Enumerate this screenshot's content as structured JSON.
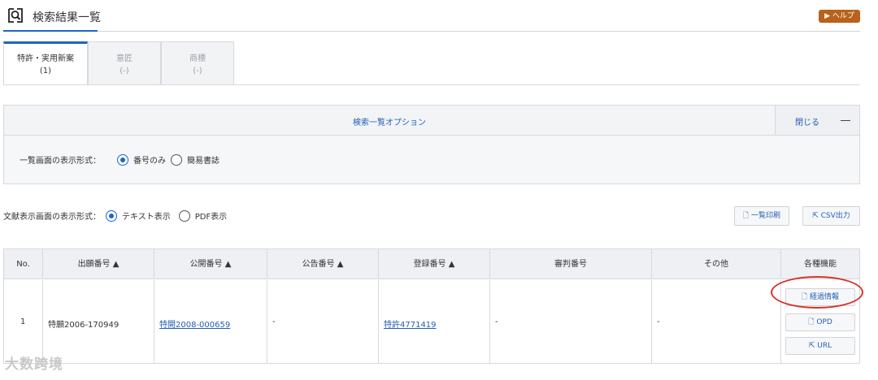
{
  "header": {
    "title": "検索結果一覧",
    "help_label": "▶ ヘルプ"
  },
  "tabs": [
    {
      "label": "特許・実用新案",
      "count": "(1)",
      "active": true
    },
    {
      "label": "意匠",
      "count": "(-)",
      "active": false
    },
    {
      "label": "商標",
      "count": "(-)",
      "active": false
    }
  ],
  "options": {
    "title": "検索一覧オプション",
    "close_label": "閉じる",
    "list_format_label": "一覧画面の表示形式：",
    "list_format_options": [
      "番号のみ",
      "簡易書誌"
    ],
    "list_format_selected": "番号のみ"
  },
  "doc_format": {
    "label": "文献表示画面の表示形式：",
    "options": [
      "テキスト表示",
      "PDF表示"
    ],
    "selected": "テキスト表示"
  },
  "actions": {
    "print_label": "一覧印刷",
    "csv_label": "CSV出力"
  },
  "table": {
    "headers": [
      "No.",
      "出願番号 ▲",
      "公開番号 ▲",
      "公告番号 ▲",
      "登録番号 ▲",
      "審判番号",
      "その他",
      "各種機能"
    ],
    "rows": [
      {
        "no": "1",
        "application": "特願2006-170949",
        "publication": "特開2008-000659",
        "announcement": "-",
        "registration": "特許4771419",
        "trial": "-",
        "other": "-",
        "functions": [
          "経過情報",
          "OPD",
          "URL"
        ]
      }
    ]
  },
  "watermark": "大数跨境",
  "colors": {
    "accent": "#1e64c8",
    "link": "#2460b4",
    "help": "#b8621b",
    "highlight_ring": "#d8322a"
  }
}
